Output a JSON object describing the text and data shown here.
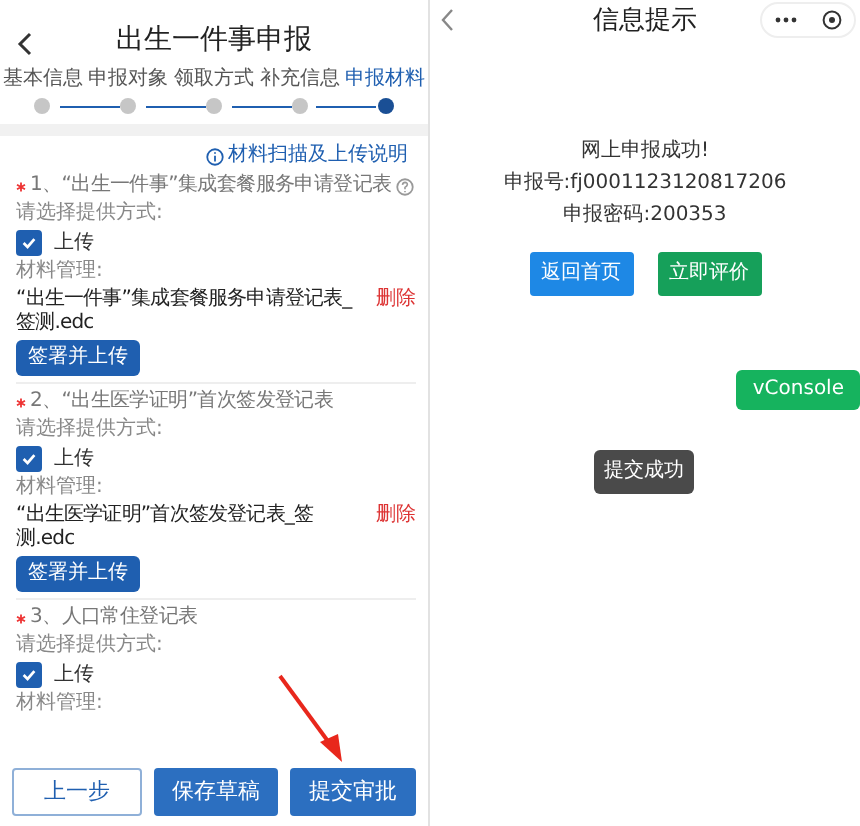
{
  "left": {
    "header": {
      "title": "出生一件事申报"
    },
    "steps": [
      {
        "label": "基本信息",
        "selected": false
      },
      {
        "label": "申报对象",
        "selected": false
      },
      {
        "label": "领取方式",
        "selected": false
      },
      {
        "label": "补充信息",
        "selected": false
      },
      {
        "label": "申报材料",
        "selected": true
      }
    ],
    "help_link": "材料扫描及上传说明",
    "items": [
      {
        "required": true,
        "title": "1、“出生一件事”集成套餐服务申请登记表",
        "help": true,
        "method_label": "请选择提供方式:",
        "option": {
          "label": "上传",
          "checked": true
        },
        "files_label": "材料管理:",
        "files": [
          {
            "name": "“出生一件事”集成套餐服务申请登记表_签测.edc",
            "delete": "删除"
          }
        ],
        "action": "签署并上传"
      },
      {
        "required": true,
        "title": "2、“出生医学证明”首次签发登记表",
        "help": false,
        "method_label": "请选择提供方式:",
        "option": {
          "label": "上传",
          "checked": true
        },
        "files_label": "材料管理:",
        "files": [
          {
            "name": "“出生医学证明”首次签发登记表_签测.edc",
            "delete": "删除"
          }
        ],
        "action": "签署并上传"
      },
      {
        "required": true,
        "title": "3、人口常住登记表",
        "help": false,
        "method_label": "请选择提供方式:",
        "option": {
          "label": "上传",
          "checked": true
        },
        "files_label": "材料管理:"
      }
    ],
    "footer": [
      {
        "label": "上一步",
        "kind": "outline"
      },
      {
        "label": "保存草稿",
        "kind": "filled"
      },
      {
        "label": "提交审批",
        "kind": "filled"
      }
    ]
  },
  "right": {
    "header": {
      "title": "信息提示"
    },
    "message": "网上申报成功!",
    "fields": [
      {
        "label": "申报号:",
        "value": "fj0001123120817206"
      },
      {
        "label": "申报密码:",
        "value": "200353"
      }
    ],
    "buttons": [
      {
        "label": "返回首页",
        "kind": "primary"
      },
      {
        "label": "立即评价",
        "kind": "success"
      }
    ],
    "vconsole": "vConsole",
    "toast": "提交成功"
  }
}
